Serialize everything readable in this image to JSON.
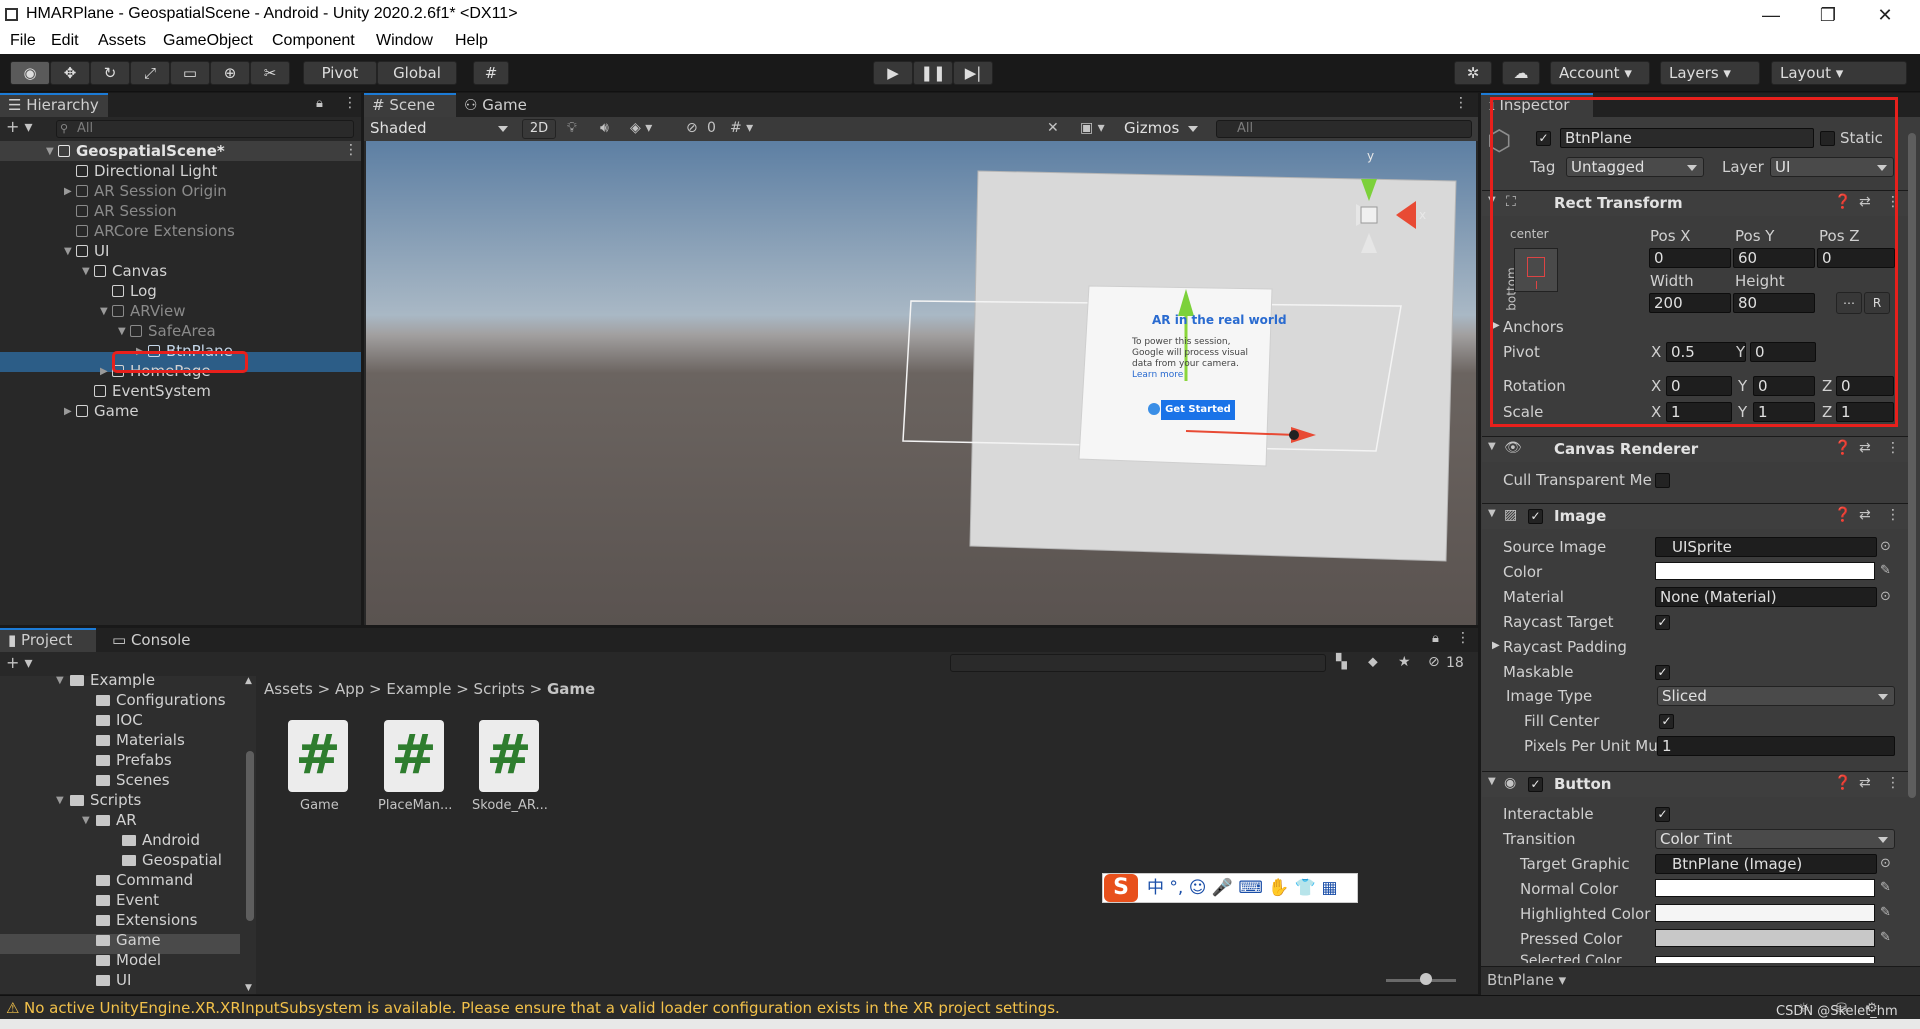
{
  "window": {
    "title": "HMARPlane - GeospatialScene - Android - Unity 2020.2.6f1* <DX11>",
    "minimize": "—",
    "restore": "❐",
    "close": "✕"
  },
  "menu": [
    "File",
    "Edit",
    "Assets",
    "GameObject",
    "Component",
    "Window",
    "Help"
  ],
  "toolbar": {
    "pivot": "Pivot",
    "global": "Global",
    "account": "Account",
    "layers": "Layers",
    "layout": "Layout"
  },
  "hierarchy": {
    "tab": "Hierarchy",
    "search_placeholder": "All",
    "items": [
      {
        "label": "GeospatialScene*",
        "depth": 0,
        "bold": true
      },
      {
        "label": "Directional Light",
        "depth": 1
      },
      {
        "label": "AR Session Origin",
        "depth": 1,
        "dim": true
      },
      {
        "label": "AR Session",
        "depth": 1,
        "dim": true
      },
      {
        "label": "ARCore Extensions",
        "depth": 1,
        "dim": true
      },
      {
        "label": "UI",
        "depth": 1
      },
      {
        "label": "Canvas",
        "depth": 2
      },
      {
        "label": "Log",
        "depth": 3
      },
      {
        "label": "ARView",
        "depth": 3,
        "dim": true
      },
      {
        "label": "SafeArea",
        "depth": 4,
        "dim": true
      },
      {
        "label": "BtnPlane",
        "depth": 5,
        "dim": true,
        "selected": true
      },
      {
        "label": "HomePage",
        "depth": 3
      },
      {
        "label": "EventSystem",
        "depth": 2
      },
      {
        "label": "Game",
        "depth": 1
      }
    ]
  },
  "scene": {
    "tabs": [
      "Scene",
      "Game"
    ],
    "shading": "Shaded",
    "mode_2d": "2D",
    "hidden_count": "0",
    "gizmos": "Gizmos",
    "search_placeholder": "All",
    "canvas_heading": "AR in the real world",
    "canvas_body": "To power this session, Google will process visual data from your camera.",
    "canvas_link": "Learn more",
    "canvas_button": "Get Started",
    "axis_y": "y",
    "axis_x": "x"
  },
  "project": {
    "tabs": [
      "Project",
      "Console"
    ],
    "hidden_count": "18",
    "tree": [
      {
        "label": "Example",
        "depth": 0,
        "open": true
      },
      {
        "label": "Configurations",
        "depth": 1
      },
      {
        "label": "IOC",
        "depth": 1
      },
      {
        "label": "Materials",
        "depth": 1
      },
      {
        "label": "Prefabs",
        "depth": 1
      },
      {
        "label": "Scenes",
        "depth": 1
      },
      {
        "label": "Scripts",
        "depth": 0,
        "open": true,
        "indent": 1
      },
      {
        "label": "AR",
        "depth": 2,
        "open": true
      },
      {
        "label": "Android",
        "depth": 3
      },
      {
        "label": "Geospatial",
        "depth": 3
      },
      {
        "label": "Command",
        "depth": 2
      },
      {
        "label": "Event",
        "depth": 2
      },
      {
        "label": "Extensions",
        "depth": 2
      },
      {
        "label": "Game",
        "depth": 2,
        "selected": true
      },
      {
        "label": "Model",
        "depth": 2
      },
      {
        "label": "UI",
        "depth": 2
      }
    ],
    "breadcrumb": [
      "Assets",
      "App",
      "Example",
      "Scripts",
      "Game"
    ],
    "files": [
      "Game",
      "PlaceMan...",
      "Skode_AR..."
    ],
    "file_glyph": "#"
  },
  "inspector": {
    "tab": "Inspector",
    "object_name": "BtnPlane",
    "static_label": "Static",
    "tag_label": "Tag",
    "tag_value": "Untagged",
    "layer_label": "Layer",
    "layer_value": "UI",
    "rect": {
      "title": "Rect Transform",
      "anchor_h": "center",
      "anchor_v": "bottom",
      "posx_label": "Pos X",
      "posy_label": "Pos Y",
      "posz_label": "Pos Z",
      "posx": "0",
      "posy": "60",
      "posz": "0",
      "width_label": "Width",
      "height_label": "Height",
      "width": "200",
      "height": "80",
      "r_btn": "R",
      "anchors": "Anchors",
      "pivot": "Pivot",
      "pivot_x": "0.5",
      "pivot_y": "0",
      "rotation": "Rotation",
      "rot_x": "0",
      "rot_y": "0",
      "rot_z": "0",
      "scale": "Scale",
      "scale_x": "1",
      "scale_y": "1",
      "scale_z": "1",
      "x": "X",
      "y": "Y",
      "z": "Z"
    },
    "canvas_renderer": {
      "title": "Canvas Renderer",
      "cull_label": "Cull Transparent Me"
    },
    "image": {
      "title": "Image",
      "source_label": "Source Image",
      "source_value": "UISprite",
      "color_label": "Color",
      "material_label": "Material",
      "material_value": "None (Material)",
      "raycast_label": "Raycast Target",
      "padding_label": "Raycast Padding",
      "maskable_label": "Maskable",
      "type_label": "Image Type",
      "type_value": "Sliced",
      "fill_label": "Fill Center",
      "ppu_label": "Pixels Per Unit Mu",
      "ppu_value": "1"
    },
    "button": {
      "title": "Button",
      "interactable_label": "Interactable",
      "transition_label": "Transition",
      "transition_value": "Color Tint",
      "target_label": "Target Graphic",
      "target_value": "BtnPlane (Image)",
      "normal_label": "Normal Color",
      "highlighted_label": "Highlighted Color",
      "pressed_label": "Pressed Color",
      "selected_label": "Selected Color"
    },
    "footer_name": "BtnPlane"
  },
  "statusbar": {
    "message": "No active UnityEngine.XR.XRInputSubsystem is available. Please ensure that a valid loader configuration exists in the XR project settings.",
    "watermark": "CSDN @Skelet_hm"
  },
  "ime": {
    "chars": "中 °, ☺ 🎤 ⌨ ✋ 👕 ▦"
  },
  "colors": {
    "accent": "#1c7bd6",
    "selection": "#2c5d87",
    "highlight_box": "#e8201c",
    "warning": "#f2c14a"
  }
}
